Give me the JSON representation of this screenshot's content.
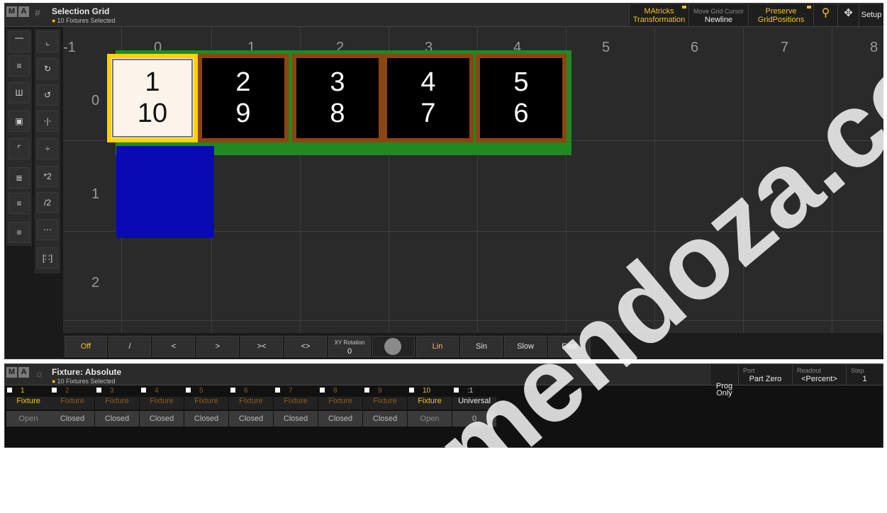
{
  "grid_window": {
    "title": "Selection Grid",
    "subtitle": "10 Fixtures Selected",
    "logo": [
      "M",
      "A"
    ],
    "buttons": {
      "transformation_1": "MAtricks",
      "transformation_2": "Transformation",
      "move_cursor_label": "Move Grid Cursor",
      "move_cursor_value": "Newline",
      "preserve_1": "Preserve",
      "preserve_2": "GridPositions",
      "setup": "Setup"
    },
    "column_numbers": [
      "-1",
      "0",
      "1",
      "2",
      "3",
      "4",
      "5",
      "6",
      "7",
      "8"
    ],
    "row_numbers": [
      "0",
      "1",
      "2"
    ],
    "fixtures": [
      {
        "top": "1",
        "bottom": "10"
      },
      {
        "top": "2",
        "bottom": "9"
      },
      {
        "top": "3",
        "bottom": "8"
      },
      {
        "top": "4",
        "bottom": "7"
      },
      {
        "top": "5",
        "bottom": "6"
      }
    ],
    "tool_labels": {
      "times2": "*2",
      "div2": "/2"
    },
    "toolbar": {
      "off": "Off",
      "slash": "/",
      "lt": "<",
      "gt": ">",
      "gtlt": "><",
      "ltgt": "<>",
      "xy_rotation_label": "XY Rotation",
      "xy_rotation_value": "0",
      "lin": "Lin",
      "sin": "Sin",
      "slow": "Slow",
      "fast": "Fast"
    }
  },
  "fixture_window": {
    "title": "Fixture: Absolute",
    "subtitle": "10 Fixtures Selected",
    "logo": [
      "M",
      "A"
    ],
    "prog_only": "Prog\nOnly",
    "port_label": "Port",
    "port_value": "Part Zero",
    "readout_label": "Readout",
    "readout_value": "<Percent>",
    "step_label": "Step",
    "step_value": "1",
    "columns": [
      {
        "num": "1",
        "type": "Fixture",
        "value": "Open"
      },
      {
        "num": "2",
        "type": "Fixture",
        "value": "Closed"
      },
      {
        "num": "3",
        "type": "Fixture",
        "value": "Closed"
      },
      {
        "num": "4",
        "type": "Fixture",
        "value": "Closed"
      },
      {
        "num": "5",
        "type": "Fixture",
        "value": "Closed"
      },
      {
        "num": "6",
        "type": "Fixture",
        "value": "Closed"
      },
      {
        "num": "7",
        "type": "Fixture",
        "value": "Closed"
      },
      {
        "num": "8",
        "type": "Fixture",
        "value": "Closed"
      },
      {
        "num": "9",
        "type": "Fixture",
        "value": "Closed"
      },
      {
        "num": "10",
        "type": "Fixture",
        "value": "Open"
      },
      {
        "num": ":1",
        "type": "Universal",
        "value": "0"
      }
    ]
  },
  "watermark": "mendoza.com",
  "colors": {
    "accent": "#f0c419",
    "selection": "#1f8a1f",
    "fixture_border": "#8b4513",
    "blue_block": "#0a0ab4"
  }
}
